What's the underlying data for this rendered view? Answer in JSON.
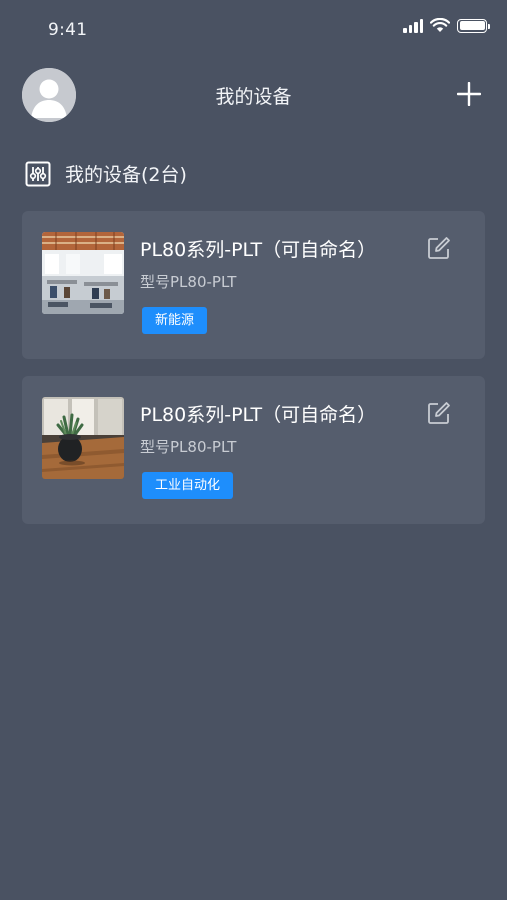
{
  "status_bar": {
    "time": "9:41",
    "icons": [
      "cellular-signal-icon",
      "wifi-icon",
      "battery-icon"
    ]
  },
  "header": {
    "title": "我的设备",
    "avatar_icon": "user-avatar-icon",
    "add_icon": "plus-icon"
  },
  "section": {
    "icon": "equalizer-sliders-icon",
    "title": "我的设备(2台)"
  },
  "devices": [
    {
      "name": "PL80系列-PLT（可自命名）",
      "model": "型号PL80-PLT",
      "tag": "新能源",
      "image": "office-interior-photo",
      "edit_icon": "edit-icon"
    },
    {
      "name": "PL80系列-PLT（可自命名）",
      "model": "型号PL80-PLT",
      "tag": "工业自动化",
      "image": "potted-plant-on-table-photo",
      "edit_icon": "edit-icon"
    }
  ],
  "colors": {
    "background": "#4a5262",
    "card": "#555d6d",
    "tag": "#1e8efc",
    "text": "#ffffff",
    "muted_text": "#c8ccd3"
  }
}
